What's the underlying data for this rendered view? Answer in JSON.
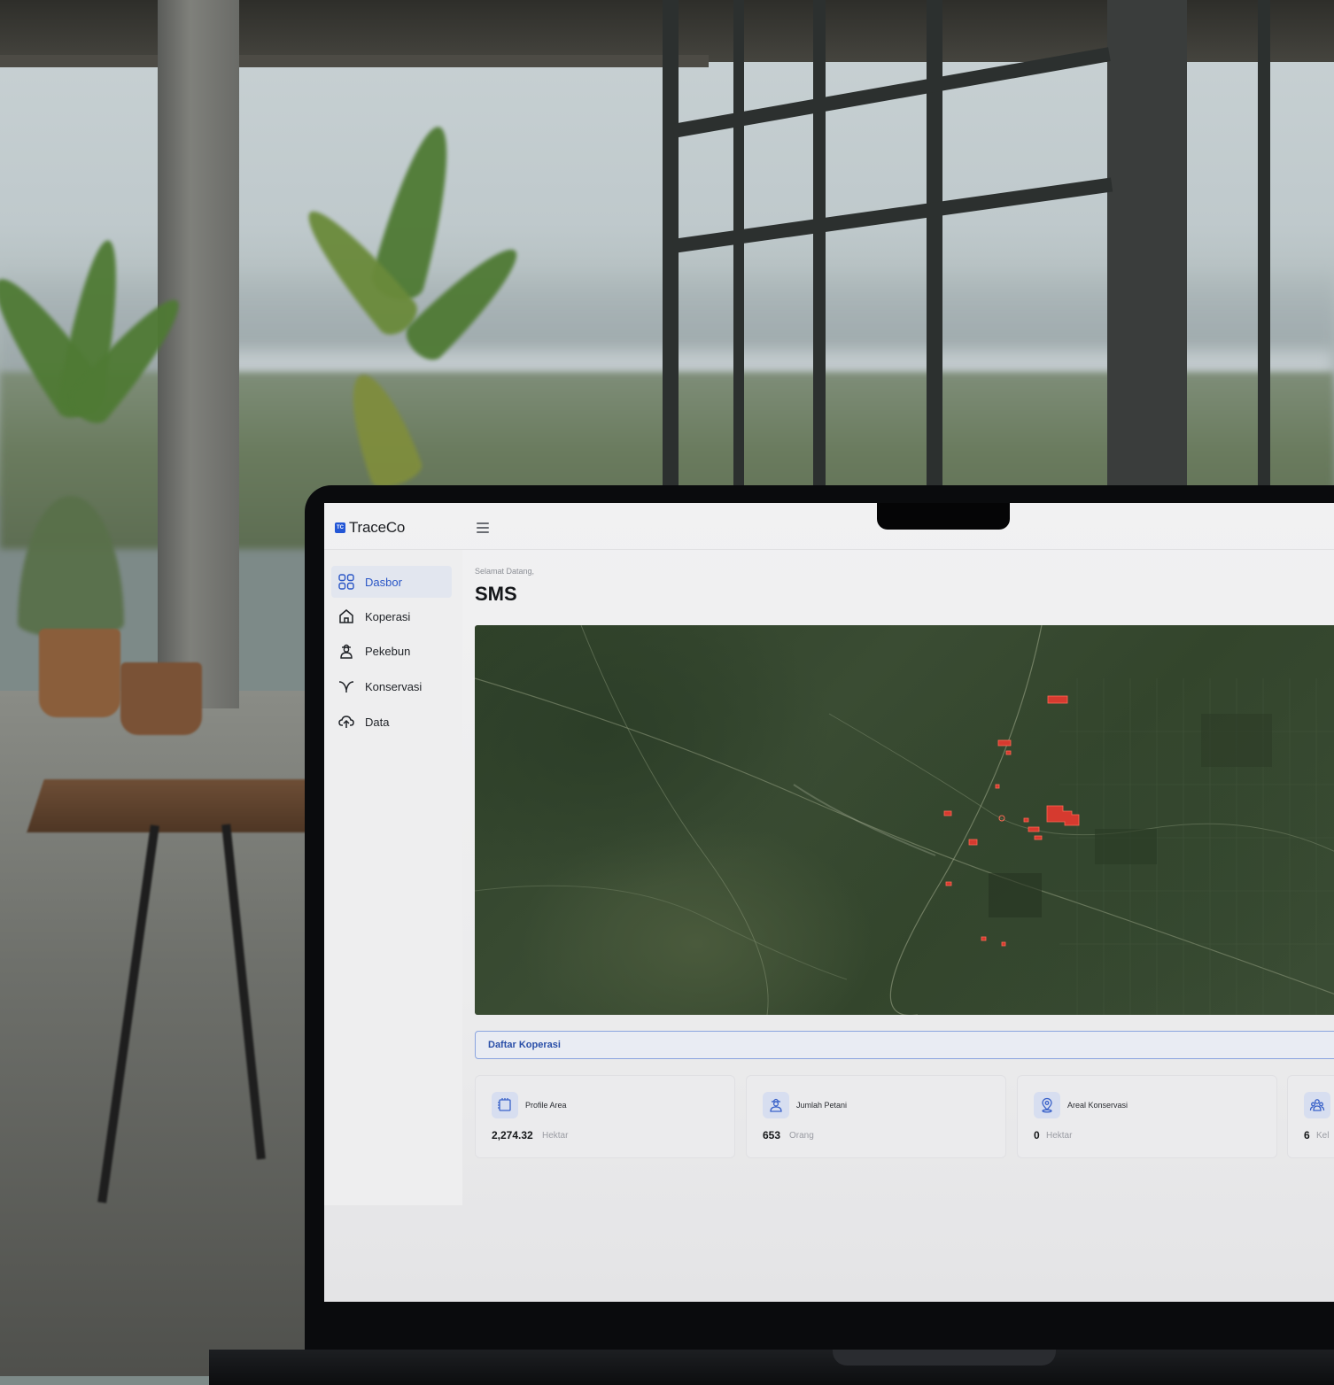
{
  "app": {
    "logo_mark": "TC",
    "name": "TraceCo"
  },
  "sidebar": {
    "items": [
      {
        "label": "Dasbor",
        "icon": "grid-icon",
        "active": true
      },
      {
        "label": "Koperasi",
        "icon": "home-icon",
        "active": false
      },
      {
        "label": "Pekebun",
        "icon": "farmer-icon",
        "active": false
      },
      {
        "label": "Konservasi",
        "icon": "leaf-icon",
        "active": false
      },
      {
        "label": "Data",
        "icon": "cloud-upload-icon",
        "active": false
      }
    ]
  },
  "main": {
    "welcome": "Selamat Datang,",
    "title": "SMS",
    "section_label": "Daftar Koperasi",
    "cards": [
      {
        "label": "Profile Area",
        "value": "2,274.32",
        "unit": "Hektar",
        "icon": "area-icon"
      },
      {
        "label": "Jumlah Petani",
        "value": "653",
        "unit": "Orang",
        "icon": "farmer-icon"
      },
      {
        "label": "Areal Konservasi",
        "value": "0",
        "unit": "Hektar",
        "icon": "location-pin-icon"
      },
      {
        "label": "",
        "value": "6",
        "unit": "Kel",
        "icon": "group-icon"
      }
    ]
  },
  "colors": {
    "accent": "#2a56c6",
    "map_highlight": "#d63a2f"
  }
}
